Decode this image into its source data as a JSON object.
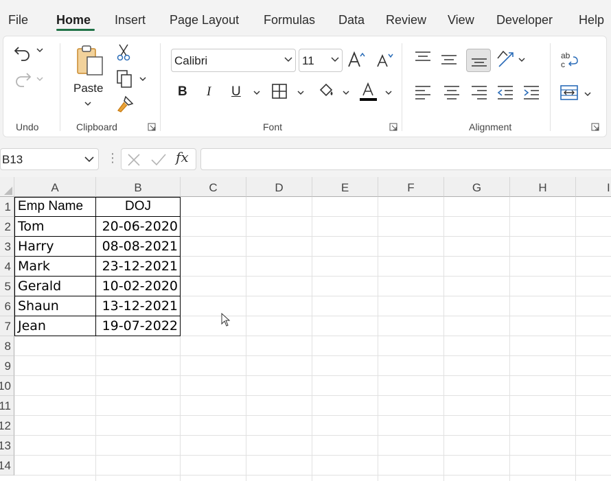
{
  "menu": {
    "items": [
      "File",
      "Home",
      "Insert",
      "Page Layout",
      "Formulas",
      "Data",
      "Review",
      "View",
      "Developer",
      "Help"
    ],
    "active": "Home"
  },
  "ribbon": {
    "groups": {
      "undo": "Undo",
      "clipboard": "Clipboard",
      "font": "Font",
      "alignment": "Alignment"
    },
    "paste_label": "Paste",
    "font_name": "Calibri",
    "font_size": "11",
    "font_color": "#000000",
    "icons": [
      "undo-icon",
      "redo-icon",
      "paste-icon",
      "cut-icon",
      "copy-icon",
      "format-painter-icon",
      "increase-font-icon",
      "decrease-font-icon",
      "bold-icon",
      "italic-icon",
      "underline-icon",
      "borders-icon",
      "fill-color-icon",
      "font-color-icon",
      "align-top-icon",
      "align-middle-icon",
      "align-bottom-icon",
      "orientation-icon",
      "wrap-text-icon",
      "align-left-icon",
      "align-center-icon",
      "align-right-icon",
      "decrease-indent-icon",
      "increase-indent-icon",
      "merge-center-icon"
    ]
  },
  "formula_bar": {
    "name_box": "B13",
    "fx_label": "fx",
    "formula": ""
  },
  "sheet": {
    "columns": [
      "A",
      "B",
      "C",
      "D",
      "E",
      "F",
      "G",
      "H",
      "I"
    ],
    "rows": [
      "1",
      "2",
      "3",
      "4",
      "5",
      "6",
      "7",
      "8",
      "9",
      "10",
      "11",
      "12",
      "13",
      "14"
    ],
    "header": {
      "name": "Emp Name",
      "doj": "DOJ"
    },
    "data": [
      {
        "name": "Tom",
        "doj": "20-06-2020"
      },
      {
        "name": "Harry",
        "doj": "08-08-2021"
      },
      {
        "name": "Mark",
        "doj": "23-12-2021"
      },
      {
        "name": "Gerald",
        "doj": "10-02-2020"
      },
      {
        "name": "Shaun",
        "doj": "13-12-2021"
      },
      {
        "name": "Jean",
        "doj": "19-07-2022"
      }
    ]
  },
  "colors": {
    "accent": "#1e7145",
    "ribbon_bg": "#f3f3f3",
    "header_bg": "#f0f0f0",
    "gridline": "#e1e1e1"
  }
}
